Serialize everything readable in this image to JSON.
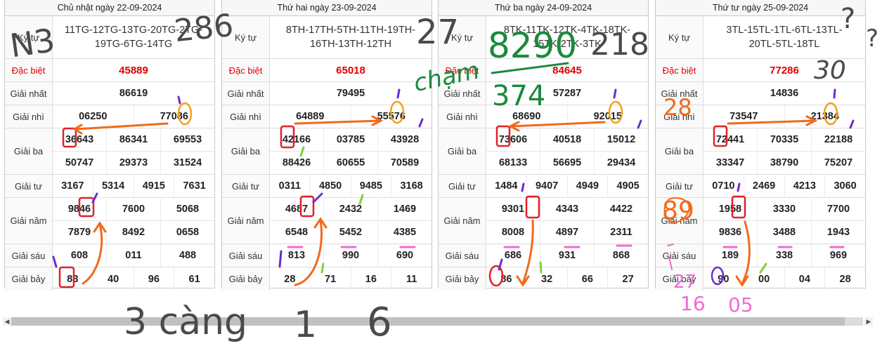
{
  "labels": {
    "kytu": "Ký tự",
    "dacbiet": "Đặc biệt",
    "nhat": "Giải nhất",
    "nhi": "Giải nhì",
    "ba": "Giải ba",
    "tu": "Giải tư",
    "nam": "Giải năm",
    "sau": "Giải sáu",
    "bay": "Giải bảy"
  },
  "boards": [
    {
      "date": "Chủ nhật ngày 22-09-2024",
      "code_line1": "11TG-12TG-13TG-20TG-2TG-",
      "code_line2": "19TG-6TG-14TG",
      "dacbiet": "45889",
      "nhat": "86619",
      "nhi": [
        "06250",
        "77086"
      ],
      "ba1": [
        "36643",
        "86341",
        "69553"
      ],
      "ba2": [
        "50747",
        "29373",
        "31524"
      ],
      "tu": [
        "3167",
        "5314",
        "4915",
        "7631"
      ],
      "nam1": [
        "9846",
        "7600",
        "5068"
      ],
      "nam2": [
        "7879",
        "8492",
        "0658"
      ],
      "sau": [
        "608",
        "011",
        "488"
      ],
      "bay": [
        "83",
        "40",
        "96",
        "61"
      ]
    },
    {
      "date": "Thứ hai ngày 23-09-2024",
      "code_line1": "8TH-17TH-5TH-11TH-19TH-",
      "code_line2": "16TH-13TH-12TH",
      "dacbiet": "65018",
      "nhat": "79495",
      "nhi": [
        "64889",
        "55576"
      ],
      "ba1": [
        "42166",
        "03785",
        "43928"
      ],
      "ba2": [
        "88426",
        "60655",
        "70589"
      ],
      "tu": [
        "0311",
        "4850",
        "9485",
        "3168"
      ],
      "nam1": [
        "4687",
        "2432",
        "1469"
      ],
      "nam2": [
        "6548",
        "5452",
        "4385"
      ],
      "sau": [
        "813",
        "990",
        "690"
      ],
      "bay": [
        "28",
        "71",
        "16",
        "11"
      ]
    },
    {
      "date": "Thứ ba ngày 24-09-2024",
      "code_line1": "8TK-11TK-12TK-4TK-18TK-",
      "code_line2": "15TK-2TK-3TK",
      "dacbiet": "84645",
      "nhat": "57287",
      "nhi": [
        "68690",
        "92015"
      ],
      "ba1": [
        "73606",
        "40518",
        "15012"
      ],
      "ba2": [
        "68133",
        "56695",
        "29434"
      ],
      "tu": [
        "1484",
        "9407",
        "4949",
        "4905"
      ],
      "nam1": [
        "9301",
        "4343",
        "4422"
      ],
      "nam2": [
        "8008",
        "4897",
        "2311"
      ],
      "sau": [
        "686",
        "931",
        "868"
      ],
      "bay": [
        "86",
        "32",
        "66",
        "27"
      ]
    },
    {
      "date": "Thứ tư ngày 25-09-2024",
      "code_line1": "3TL-15TL-1TL-6TL-13TL-",
      "code_line2": "20TL-5TL-18TL",
      "dacbiet": "77286",
      "nhat": "14836",
      "nhi": [
        "73547",
        "21384"
      ],
      "ba1": [
        "72441",
        "70335",
        "22188"
      ],
      "ba2": [
        "33347",
        "38790",
        "75207"
      ],
      "tu": [
        "0710",
        "2469",
        "4213",
        "3060"
      ],
      "nam1": [
        "1958",
        "3330",
        "7700"
      ],
      "nam2": [
        "9836",
        "3488",
        "1943"
      ],
      "sau": [
        "189",
        "338",
        "969"
      ],
      "bay": [
        "90",
        "00",
        "04",
        "28"
      ]
    }
  ],
  "handwriting": {
    "n3": "N3",
    "n286": "286",
    "n27": "27",
    "cham": "chạm",
    "n8290": "8290",
    "n374": "374",
    "n218": "218",
    "n30": "30",
    "n28": "28",
    "n89": "89",
    "n27b": "27",
    "n16": "16",
    "n05": "05",
    "n1": "1",
    "n6": "6",
    "q1": "?",
    "q2": "?",
    "bottom_text": "3 càng"
  },
  "colors": {
    "red_prize": "#e20000",
    "ink_red": "#e0202a",
    "ink_orange": "#f26a1b",
    "ink_green": "#1a8a3c",
    "ink_purple": "#6a2bd1",
    "ink_pink": "#f06ad6",
    "ink_gray": "#4a4a4a"
  }
}
